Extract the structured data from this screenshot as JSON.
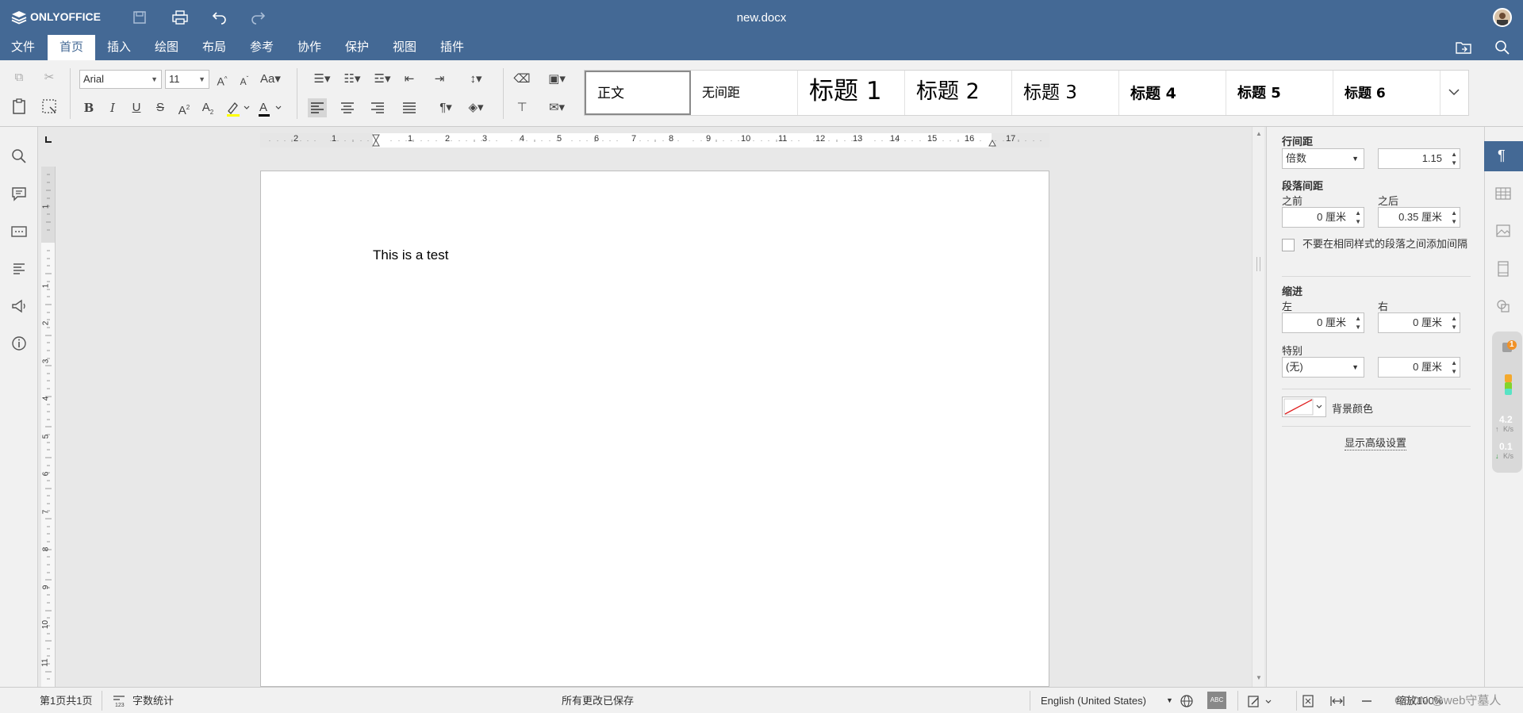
{
  "app": {
    "brand": "ONLYOFFICE",
    "doc_title": "new.docx"
  },
  "nav": {
    "tabs": [
      "文件",
      "首页",
      "插入",
      "绘图",
      "布局",
      "参考",
      "协作",
      "保护",
      "视图",
      "插件"
    ],
    "active": "首页"
  },
  "toolbar": {
    "font_name": "Arial",
    "font_size": "11"
  },
  "styles": [
    "正文",
    "无间距",
    "标题 1",
    "标题 2",
    "标题 3",
    "标题 4",
    "标题 5",
    "标题 6"
  ],
  "ruler": {
    "h_labels": [
      "2",
      "1",
      "1",
      "2",
      "3",
      "4",
      "5",
      "6",
      "7",
      "8",
      "9",
      "10",
      "11",
      "12",
      "13",
      "14",
      "15",
      "16",
      "17"
    ],
    "v_labels": [
      "1",
      "1",
      "2",
      "3",
      "4",
      "5",
      "6",
      "7",
      "8",
      "9",
      "10",
      "11"
    ]
  },
  "document": {
    "text": "This is a test"
  },
  "panel": {
    "line_spacing_label": "行间距",
    "line_spacing_mode": "倍数",
    "line_spacing_value": "1.15",
    "para_spacing_label": "段落间距",
    "before_label": "之前",
    "before_value": "0 厘米",
    "after_label": "之后",
    "after_value": "0.35 厘米",
    "no_space_checkbox": "不要在相同样式的段落之间添加间隔",
    "indent_label": "缩进",
    "left_label": "左",
    "left_value": "0 厘米",
    "right_label": "右",
    "right_value": "0 厘米",
    "special_label": "特别",
    "special_value": "(无)",
    "special_amount": "0 厘米",
    "bg_color_label": "背景颜色",
    "advanced_link": "显示高级设置"
  },
  "overlay": {
    "badge": "1",
    "up_speed": "4.2",
    "down_speed": "0.1",
    "unit": "K/s"
  },
  "status": {
    "page": "第1页共1页",
    "word_count": "字数统计",
    "saved": "所有更改已保存",
    "language": "English (United States)",
    "zoom": "缩放100%",
    "watermark": "CSDN @web守墓人"
  },
  "colors": {
    "brand": "#446995",
    "toolbar": "#f1f1f1",
    "highlight": "#ffff00"
  }
}
